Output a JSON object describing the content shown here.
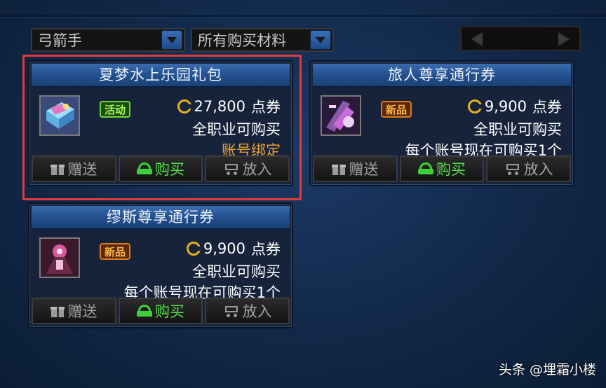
{
  "filters": {
    "class_select": "弓箭手",
    "material_select": "所有购买材料"
  },
  "cards": [
    {
      "title": "夏梦水上乐园礼包",
      "badge": "活动",
      "price": "27,800",
      "currency": "点券",
      "line2": "全职业可购买",
      "line3": "账号绑定",
      "actions": {
        "gift": "赠送",
        "buy": "购买",
        "cart": "放入"
      }
    },
    {
      "title": "旅人尊享通行券",
      "badge": "新品",
      "price": "9,900",
      "currency": "点券",
      "line2": "全职业可购买",
      "line3": "每个账号现在可购买1个",
      "actions": {
        "gift": "赠送",
        "buy": "购买",
        "cart": "放入"
      }
    },
    {
      "title": "缪斯尊享通行券",
      "badge": "新品",
      "price": "9,900",
      "currency": "点券",
      "line2": "全职业可购买",
      "line3": "每个账号现在可购买1个",
      "actions": {
        "gift": "赠送",
        "buy": "购买",
        "cart": "放入"
      }
    }
  ],
  "watermark": "头条 @埋霜小楼",
  "colors": {
    "highlight": "#e23b3b",
    "buy_green": "#52e04a",
    "badge_event": "#6dd63b",
    "badge_new": "#e07a1e",
    "bind_orange": "#f0a030"
  }
}
